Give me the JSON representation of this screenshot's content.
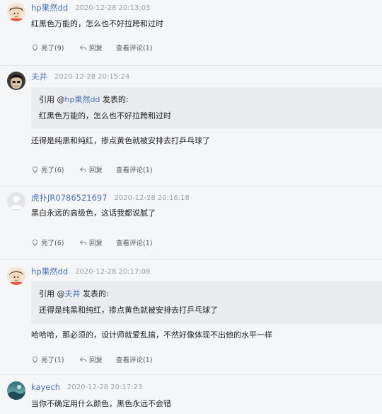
{
  "comments": [
    {
      "author": "hp果然dd",
      "time": "2020-12-28 20:13:03",
      "text": "红黑色万能的，怎么也不好拉跨和过时",
      "actions": {
        "like": "亮了(9)",
        "reply": "回复",
        "view": "查看评论(1)"
      }
    },
    {
      "author": "夫井",
      "time": "2020-12-28 20:15:24",
      "quote": {
        "prefix": "引用 @",
        "user": "hp果然dd",
        "suffix": " 发表的:",
        "text": "红黑色万能的，怎么也不好拉跨和过时"
      },
      "text": "还得是纯黑和纯红，掺点黄色就被安排去打乒乓球了",
      "actions": {
        "like": "亮了(6)",
        "reply": "回复",
        "view": "查看评论(1)"
      }
    },
    {
      "author": "虎扑JR0786521697",
      "time": "2020-12-28 20:16:18",
      "text": "黑白永远的高级色，这话我都说腻了",
      "actions": {
        "like": "亮了(6)",
        "reply": "回复",
        "view": "查看评论(1)"
      }
    },
    {
      "author": "hp果然dd",
      "time": "2020-12-28 20:17:08",
      "quote": {
        "prefix": "引用 @",
        "user": "夫井",
        "suffix": " 发表的:",
        "text": "还得是纯黑和纯红，掺点黄色就被安排去打乒乓球了"
      },
      "text": "哈哈哈，那必须的，设计师就爱乱搞，不然好像体现不出他的水平一样",
      "actions": {
        "like": "亮了(1)",
        "reply": "回复",
        "view": "查看评论(1)"
      }
    },
    {
      "author": "kayech",
      "time": "2020-12-28 20:17:23",
      "text": "当你不确定用什么颜色，黑色永远不会错"
    }
  ]
}
